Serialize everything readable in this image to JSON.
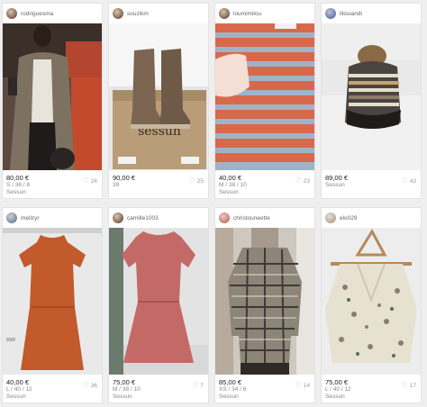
{
  "items": [
    {
      "user": "rodriguesma",
      "price": "80,00 €",
      "size": "S / 36 / 8",
      "brand": "Sessun",
      "likes": "24",
      "avatar_color": "#a2846b"
    },
    {
      "user": "souzikm",
      "price": "90,00 €",
      "size": "39",
      "brand": "",
      "likes": "25",
      "avatar_color": "#b59a83"
    },
    {
      "user": "loumimilou",
      "price": "40,00 €",
      "size": "M / 38 / 10",
      "brand": "Sessun",
      "likes": "23",
      "avatar_color": "#c79a7f"
    },
    {
      "user": "lilisoandi",
      "price": "89,00 €",
      "size": "",
      "brand": "Sessun",
      "likes": "43",
      "avatar_color": "#6a78a8"
    },
    {
      "user": "mellzyr",
      "price": "40,00 €",
      "size": "L / 40 / 12",
      "brand": "Sessun",
      "likes": "36",
      "avatar_color": "#7a8a9c"
    },
    {
      "user": "camille1003",
      "price": "75,00 €",
      "size": "M / 38 / 10",
      "brand": "Sessun",
      "likes": "7",
      "avatar_color": "#a88a70"
    },
    {
      "user": "christouneette",
      "price": "85,00 €",
      "size": "XS / 34 / 6",
      "brand": "Sessun",
      "likes": "14",
      "avatar_color": "#c27b6e"
    },
    {
      "user": "elo029",
      "price": "75,00 €",
      "size": "L / 40 / 12",
      "brand": "Sessun",
      "likes": "17",
      "avatar_color": "#b8a89a"
    }
  ],
  "photo_names": [
    "woman-in-gray-coat-photo",
    "brown-boots-on-sessun-box-photo",
    "striped-skirt-photo",
    "woven-backpack-photo",
    "orange-dress-photo",
    "pink-dress-photo",
    "plaid-shirt-photo",
    "floral-blouse-photo"
  ],
  "box_brand_text": "sessun"
}
